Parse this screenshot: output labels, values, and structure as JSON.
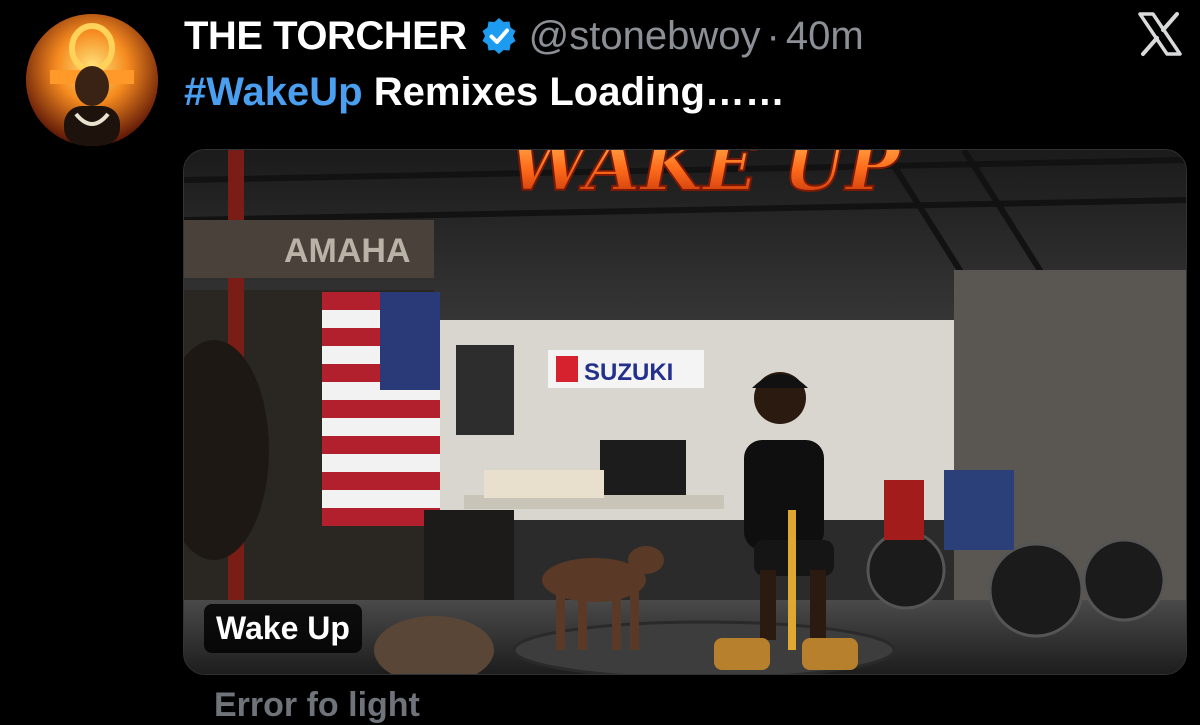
{
  "tweet": {
    "display_name": "THE TORCHER",
    "handle": "@stonebwoy",
    "separator": "·",
    "time": "40m",
    "hashtag": "#WakeUp",
    "text_rest": " Remixes Loading……",
    "verified_icon": "verified-badge-icon",
    "brand_icon": "x-logo-icon"
  },
  "media": {
    "label": "Wake Up",
    "artwork_title": "WAKE UP",
    "sign_left": "AMAHA",
    "sign_suzuki": "SUZUKI"
  },
  "below_text": "Error fo light",
  "colors": {
    "background": "#000000",
    "hashtag": "#4a9ff0",
    "verified": "#1d9bf0",
    "muted": "#8b9096"
  }
}
